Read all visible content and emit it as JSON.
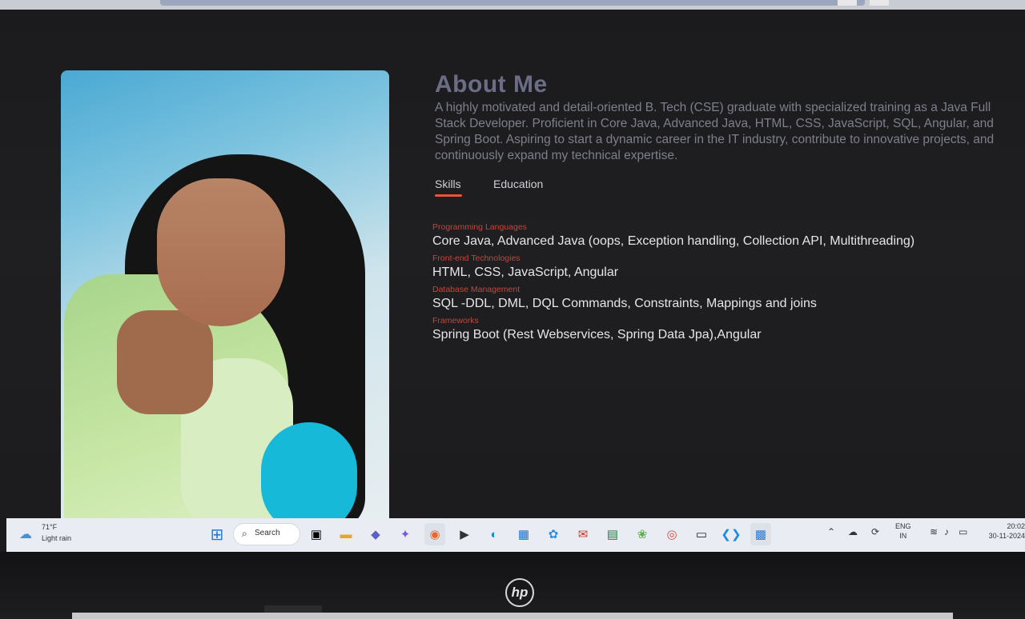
{
  "about": {
    "heading": "About Me",
    "description": "A highly motivated and detail-oriented B. Tech (CSE) graduate with specialized training as a Java Full Stack Developer. Proficient in Core Java, Advanced Java, HTML, CSS, JavaScript, SQL, Angular, and Spring Boot. Aspiring to start a dynamic career in the IT industry, contribute to innovative projects, and continuously expand my technical expertise."
  },
  "tabs": [
    {
      "label": "Skills",
      "active": true
    },
    {
      "label": "Education",
      "active": false
    }
  ],
  "skills": [
    {
      "category": "Programming Languages",
      "value": "Core Java, Advanced Java (oops, Exception handling, Collection API, Multithreading)"
    },
    {
      "category": "Front-end Technologies",
      "value": "HTML, CSS, JavaScript, Angular"
    },
    {
      "category": "Database Management",
      "value": "SQL -DDL, DML, DQL Commands, Constraints, Mappings and joins"
    },
    {
      "category": "Frameworks",
      "value": "Spring Boot (Rest Webservices, Spring Data Jpa),Angular"
    }
  ],
  "taskbar": {
    "weather": {
      "temp": "71°F",
      "condition": "Light rain",
      "icon": "rain-cloud-icon"
    },
    "search_label": "Search",
    "lang_line1": "ENG",
    "lang_line2": "IN",
    "time": "20:02",
    "date": "30-11-2024"
  },
  "colors": {
    "accent": "#e8533a",
    "heading": "#6b6d86",
    "page_bg": "#1c1c1e"
  }
}
